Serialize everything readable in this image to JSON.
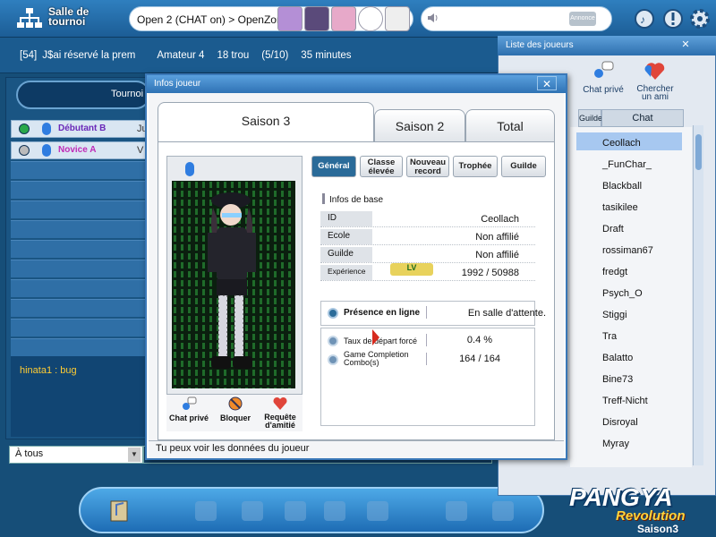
{
  "topbar": {
    "title_line1": "Salle de",
    "title_line2": "tournoi",
    "room": "Open 2 (CHAT on) > OpenZon",
    "annonce": "Annonce"
  },
  "info_line": {
    "id": "[54]",
    "room_name": "J$ai réservé la prem",
    "level": "Amateur 4",
    "holes": "18 trou",
    "slots": "(5/10)",
    "time": "35 minutes"
  },
  "left": {
    "tab_label": "Tournoi",
    "players": [
      {
        "name": "Débutant B",
        "extra": "Ju"
      },
      {
        "name": "Novice A",
        "extra": "V"
      }
    ],
    "chat_line": "hinata1 : bug",
    "chat_scope": "À tous"
  },
  "players_window": {
    "title": "Liste des joueurs",
    "btn_chat": "Chat privé",
    "btn_friend_1": "Chercher",
    "btn_friend_2": "un ami",
    "col_guild": "Guilde",
    "col_chat": "Chat",
    "names": [
      "Ceollach",
      "_FunChar_",
      "Blackball",
      "tasikilee",
      "Draft",
      "rossiman67",
      "fredgt",
      "Psych_O",
      "Stiggi",
      "Tra",
      "Balatto",
      "Bine73",
      "Treff-Nicht",
      "Disroyal",
      "Myray"
    ]
  },
  "info_window": {
    "title": "Infos joueur",
    "season_tabs": [
      "Saison 3",
      "Saison 2",
      "Total"
    ],
    "sub_tabs": {
      "general": "Général",
      "classe_1": "Classe",
      "classe_2": "élevée",
      "record_1": "Nouveau",
      "record_2": "record",
      "trophee": "Trophée",
      "guilde": "Guilde"
    },
    "section_base": "Infos de base",
    "rows": {
      "id_label": "ID",
      "id_value": "Ceollach",
      "ecole_label": "Ecole",
      "ecole_value": "Non affilié",
      "guilde_label": "Guilde",
      "guilde_value": "Non affilié",
      "xp_label": "Expérience",
      "xp_value": "1992  /  50988"
    },
    "presence_label": "Présence en ligne",
    "presence_value": "En salle d'attente.",
    "stat1_label": "Taux de départ forcé",
    "stat1_value": "0.4  %",
    "stat2_label": "Game Completion Combo(s)",
    "stat2_value": "164  /  164",
    "actions": {
      "chat": "Chat privé",
      "block": "Bloquer",
      "friend_1": "Requête",
      "friend_2": "d'amitié"
    },
    "footnote": "Tu peux voir les données du joueur"
  },
  "brand": {
    "name": "PANGYA",
    "sub": "Revolution",
    "season": "Saison3"
  }
}
